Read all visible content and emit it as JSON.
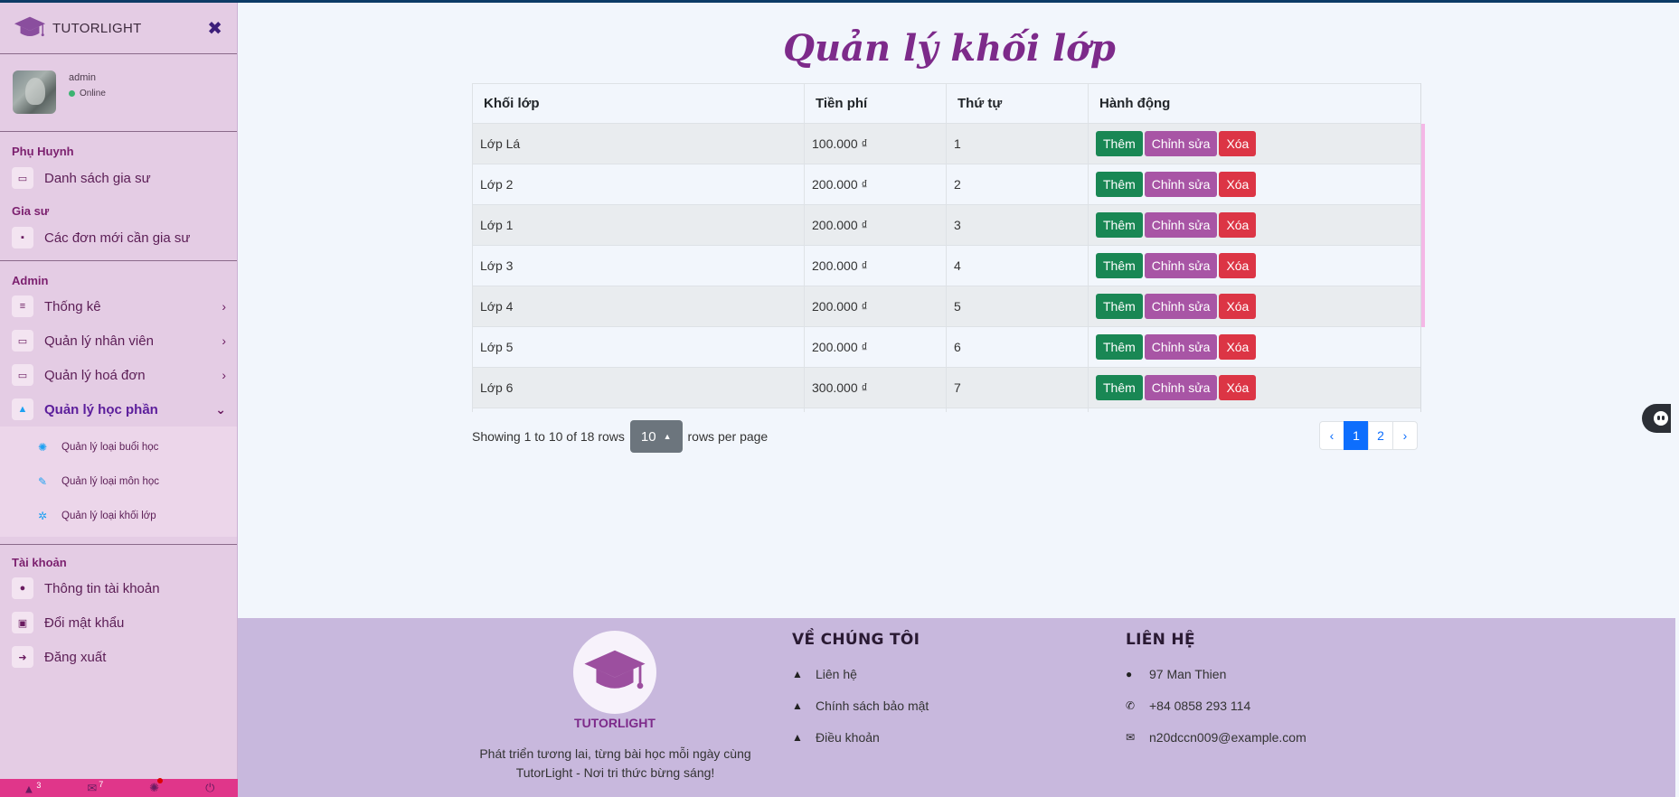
{
  "sidebar": {
    "brand": "TUTORLIGHT",
    "user": {
      "name": "admin",
      "status": "Online"
    },
    "sections": [
      {
        "title": "Phụ Huynh",
        "items": [
          {
            "label": "Danh sách gia sư",
            "icon": "id-card-icon"
          }
        ]
      },
      {
        "title": "Gia sư",
        "items": [
          {
            "label": "Các đơn mới cần gia sư",
            "icon": "calendar-icon"
          }
        ]
      },
      {
        "title": "Admin",
        "items": [
          {
            "label": "Thống kê",
            "icon": "align-left-icon"
          },
          {
            "label": "Quản lý nhân viên",
            "icon": "laptop-icon"
          },
          {
            "label": "Quản lý hoá đơn",
            "icon": "laptop-icon"
          },
          {
            "label": "Quản lý học phần",
            "icon": "graduation-cap-icon"
          }
        ],
        "subitems": [
          {
            "label": "Quản lý loại buổi học",
            "icon": "gear-icon"
          },
          {
            "label": "Quản lý loại môn học",
            "icon": "wrench-icon"
          },
          {
            "label": "Quản lý loại khối lớp",
            "icon": "gears-icon"
          }
        ]
      },
      {
        "title": "Tài khoản",
        "items": [
          {
            "label": "Thông tin tài khoản",
            "icon": "info-icon"
          },
          {
            "label": "Đổi mật khẩu",
            "icon": "unlock-icon"
          },
          {
            "label": "Đăng xuất",
            "icon": "sign-out-icon"
          }
        ]
      }
    ],
    "bottom": {
      "notifications": "3",
      "messages": "7"
    }
  },
  "main": {
    "title": "Quản lý khối lớp",
    "table": {
      "headers": [
        "Khối lớp",
        "Tiền phí",
        "Thứ tự",
        "Hành động"
      ],
      "rows": [
        [
          "Lớp Lá",
          "100.000 ₫",
          "1"
        ],
        [
          "Lớp 2",
          "200.000 ₫",
          "2"
        ],
        [
          "Lớp 1",
          "200.000 ₫",
          "3"
        ],
        [
          "Lớp 3",
          "200.000 ₫",
          "4"
        ],
        [
          "Lớp 4",
          "200.000 ₫",
          "5"
        ],
        [
          "Lớp 5",
          "200.000 ₫",
          "6"
        ],
        [
          "Lớp 6",
          "300.000 ₫",
          "7"
        ]
      ],
      "actions": {
        "add": "Thêm",
        "edit": "Chỉnh sửa",
        "delete": "Xóa"
      }
    },
    "pager": {
      "showing": "Showing 1 to 10 of 18 rows",
      "rows_per_page_value": "10",
      "rows_per_page_label": "rows per page",
      "prev": "‹",
      "pages": [
        "1",
        "2"
      ],
      "next": "›"
    }
  },
  "footer": {
    "brand": "TUTORLIGHT",
    "slogan_line1": "Phát triển tương lai, từng bài học mỗi ngày cùng",
    "slogan_line2": "TutorLight - Nơi tri thức bừng sáng!",
    "about": {
      "title": "VỀ CHÚNG TÔI",
      "links": [
        "Liên hệ",
        "Chính sách bảo mật",
        "Điều khoản"
      ]
    },
    "contact": {
      "title": "LIÊN HỆ",
      "address": "97 Man Thien",
      "phone": "+84 0858 293 114",
      "email": "n20dccn009@example.com"
    }
  },
  "colors": {
    "accent": "#7d2a8a",
    "sidebar": "#e4cce4",
    "footer": "#c8b8dd",
    "add": "#198754",
    "edit": "#a855a5",
    "delete": "#dc3545"
  }
}
